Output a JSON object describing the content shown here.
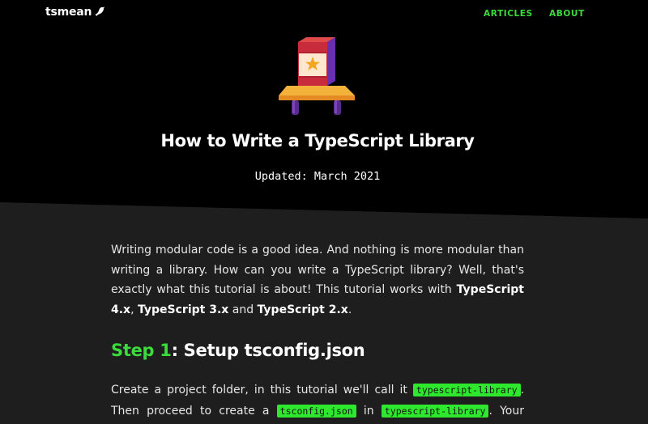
{
  "nav": {
    "logo_text": "tsmean",
    "logo_icon": "bird-icon",
    "links": [
      "ARTICLES",
      "ABOUT"
    ]
  },
  "hero": {
    "illustration_icon": "book-on-shelf-icon",
    "title": "How to Write a TypeScript Library",
    "updated": "Updated: March 2021"
  },
  "intro": {
    "text_1": "Writing modular code is a good idea. And nothing is more modular than writing a library. How can you write a TypeScript library? Well, that's exactly what this tutorial is about! This tutorial works with ",
    "bold_1": "TypeScript 4.x",
    "sep_1": ", ",
    "bold_2": "TypeScript 3.x",
    "sep_2": " and ",
    "bold_3": "TypeScript 2.x",
    "end": "."
  },
  "step1": {
    "label": "Step 1",
    "title": ": Setup tsconfig.json",
    "text_1": "Create a project folder, in this tutorial we'll call it ",
    "code_1": "typescript-library",
    "text_2": ". Then proceed to create a ",
    "code_2": "tsconfig.json",
    "text_3": " in ",
    "code_3": "typescript-library",
    "text_4": ". Your"
  },
  "colors": {
    "accent": "#3bdb3b",
    "code_bg": "#2ee82e",
    "hero_bg": "#000000",
    "content_bg": "#1e1e1e"
  }
}
